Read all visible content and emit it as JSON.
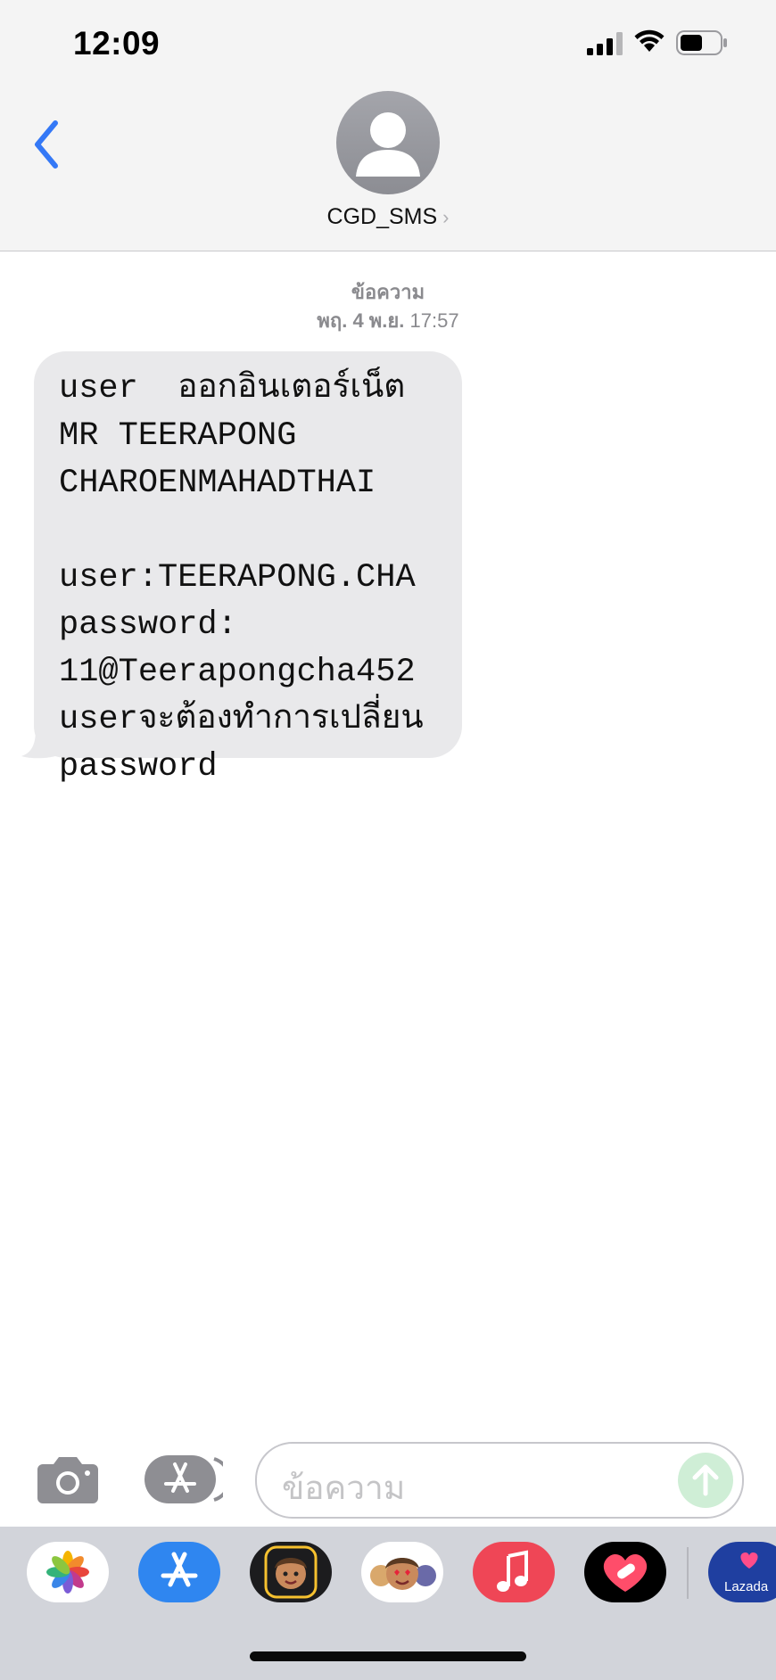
{
  "status_bar": {
    "time": "12:09"
  },
  "header": {
    "contact_name": "CGD_SMS",
    "chevron": "›"
  },
  "conversation": {
    "label": "ข้อความ",
    "timestamp_day": "พฤ. 4 พ.ย.",
    "timestamp_time": "17:57",
    "messages": [
      {
        "direction": "incoming",
        "text": "user  ออกอินเตอร์เน็ต\nMR TEERAPONG\nCHAROENMAHADTHAI\n  user:TEERAPONG.CHA\npassword:\n11@Teerapongcha452\nuserจะต้องทำการเปลี่ยน\npassword"
      }
    ]
  },
  "composer": {
    "placeholder": "ข้อความ"
  },
  "app_drawer": {
    "apps": [
      {
        "icon": "photos-icon"
      },
      {
        "icon": "app-store-icon"
      },
      {
        "icon": "memoji-camera-icon"
      },
      {
        "icon": "memoji-stickers-icon"
      },
      {
        "icon": "music-icon"
      },
      {
        "icon": "heart-app-icon"
      },
      {
        "icon": "lazada-icon",
        "label": "Lazada"
      }
    ]
  },
  "colors": {
    "accent": "#3478f6",
    "incoming_bubble": "#e9e9eb",
    "header_bg": "#f4f4f4",
    "send_disabled": "#cfeed6"
  }
}
